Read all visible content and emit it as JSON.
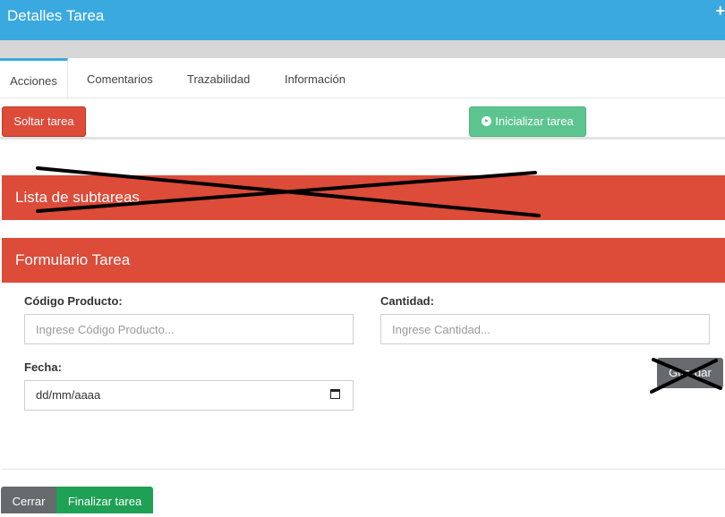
{
  "header": {
    "title": "Detalles Tarea",
    "plus_glyph": "+"
  },
  "tabs": [
    {
      "label": "Acciones"
    },
    {
      "label": "Comentarios"
    },
    {
      "label": "Trazabilidad"
    },
    {
      "label": "Información"
    }
  ],
  "actions": {
    "release_label": "Soltar tarea",
    "start_label": "Inicializar tarea",
    "start_icon": "play-circle-icon"
  },
  "subtasks": {
    "title": "Lista de subtareas",
    "crossed_out": true
  },
  "form": {
    "title": "Formulario Tarea",
    "product_code_label": "Código Producto:",
    "product_code_placeholder": "Ingrese Código Producto...",
    "quantity_label": "Cantidad:",
    "quantity_placeholder": "Ingrese Cantidad...",
    "date_label": "Fecha:",
    "date_value": "dd/mm/aaaa",
    "date_icon": "calendar-icon",
    "save_label": "Guardar",
    "save_crossed_out": true
  },
  "footer": {
    "close_label": "Cerrar",
    "finish_label": "Finalizar tarea"
  },
  "colors": {
    "header": "#3aa9e0",
    "danger": "#dd4b39",
    "start": "#5cc58f",
    "finish": "#1ea154",
    "close": "#666a6c"
  }
}
